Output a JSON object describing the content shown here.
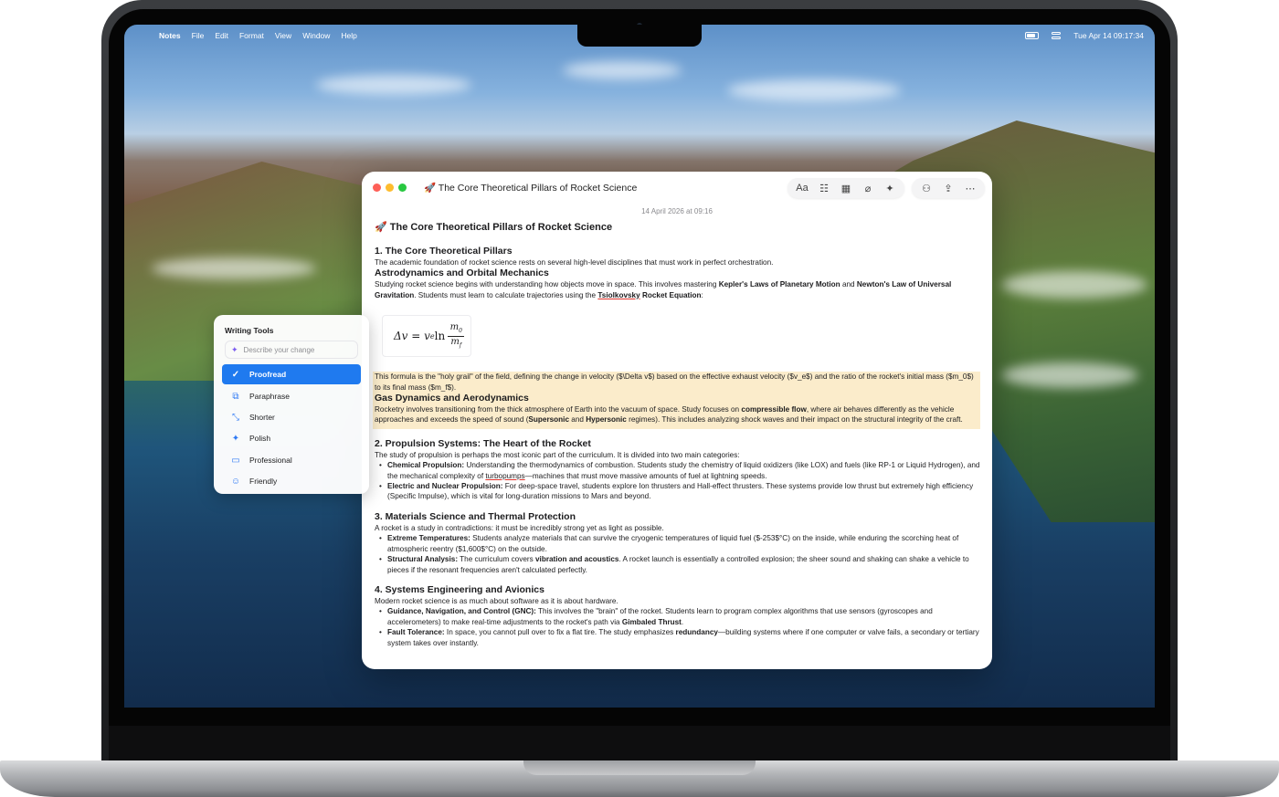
{
  "menubar": {
    "apple": "",
    "app": "Notes",
    "items": [
      "File",
      "Edit",
      "Format",
      "View",
      "Window",
      "Help"
    ],
    "clock": "Tue Apr 14  09:17:34"
  },
  "window": {
    "title": "🚀 The Core Theoretical Pillars of Rocket Science",
    "toolbar": {
      "format": "Aa",
      "checklist": "☷",
      "table": "▦",
      "attach": "⌀",
      "ai": "✦",
      "collab": "⚇",
      "share": "⇪",
      "more": "⋯"
    },
    "date": "14 April 2026 at 09:16"
  },
  "note": {
    "title": "🚀 The Core Theoretical Pillars of Rocket Science",
    "s1_heading": "1. The Core Theoretical Pillars",
    "s1_intro": "The academic foundation of rocket science rests on several high-level disciplines that must work in perfect orchestration.",
    "astro_heading": "Astrodynamics and Orbital Mechanics",
    "astro_p1": "Studying rocket science begins with understanding how objects move in space. This involves mastering ",
    "astro_b1": "Kepler's Laws of Planetary Motion",
    "astro_p2": " and ",
    "astro_b2": "Newton's Law of Universal Gravitation",
    "astro_p3": ". Students must learn to calculate trajectories using the ",
    "astro_b3": "Tsiolkovsky",
    "astro_b3b": " Rocket Equation",
    "astro_p4": ":",
    "formula": {
      "lhs": "Δv = v",
      "sub": "e",
      "ln": " ln",
      "num": "m",
      "num_sub": "0",
      "den": "m",
      "den_sub": "f"
    },
    "formula_note": "This formula is the \"holy grail\" of the field, defining the change in velocity ($\\Delta v$) based on the effective exhaust velocity ($v_e$) and the ratio of the rocket's initial mass ($m_0$) to its final mass ($m_f$).",
    "gas_heading": "Gas Dynamics and Aerodynamics",
    "gas_p1": "Rocketry involves transitioning from the thick atmosphere of Earth into the vacuum of space. Study focuses on ",
    "gas_b1": "compressible flow",
    "gas_p2": ", where air behaves differently as the vehicle approaches and exceeds the speed of sound (",
    "gas_b2": "Supersonic",
    "gas_p3": " and ",
    "gas_b3": "Hypersonic",
    "gas_p4": " regimes). This includes analyzing shock waves and their impact on the structural integrity of the craft.",
    "s2_heading": "2. Propulsion Systems: The Heart of the Rocket",
    "s2_intro": "The study of propulsion is perhaps the most iconic part of the curriculum. It is divided into two main categories:",
    "s2_li1_b": "Chemical Propulsion:",
    "s2_li1_a": " Understanding the thermodynamics of combustion. Students study the chemistry of liquid oxidizers (like LOX) and fuels (like RP-1 or Liquid Hydrogen), and the mechanical complexity of ",
    "s2_li1_u": "turbopumps",
    "s2_li1_c": "—machines that must move massive amounts of fuel at lightning speeds.",
    "s2_li2_b": "Electric and Nuclear Propulsion:",
    "s2_li2_a": " For deep-space travel, students explore Ion thrusters and Hall-effect thrusters. These systems provide low thrust but extremely high efficiency (Specific Impulse), which is vital for long-duration missions to Mars and beyond.",
    "s3_heading": "3. Materials Science and Thermal Protection",
    "s3_intro": "A rocket is a study in contradictions: it must be incredibly strong yet as light as possible.",
    "s3_li1_b": "Extreme Temperatures:",
    "s3_li1_a": " Students analyze materials that can survive the cryogenic temperatures of liquid fuel ($-253$°C) on the inside, while enduring the scorching heat of atmospheric reentry ($1,600$°C) on the outside.",
    "s3_li2_b": "Structural Analysis:",
    "s3_li2_a": " The curriculum covers ",
    "s3_li2_b2": "vibration and acoustics",
    "s3_li2_c": ". A rocket launch is essentially a controlled explosion; the sheer sound and shaking can shake a vehicle to pieces if the resonant frequencies aren't calculated perfectly.",
    "s4_heading": "4. Systems Engineering and Avionics",
    "s4_intro": "Modern rocket science is as much about software as it is about hardware.",
    "s4_li1_b": "Guidance, Navigation, and Control (GNC):",
    "s4_li1_a": " This involves the \"brain\" of the rocket. Students learn to program complex algorithms that use sensors (gyroscopes and accelerometers) to make real-time adjustments to the rocket's path via ",
    "s4_li1_b2": "Gimbaled Thrust",
    "s4_li1_c": ".",
    "s4_li2_b": "Fault Tolerance:",
    "s4_li2_a": " In space, you cannot pull over to fix a flat tire. The study emphasizes ",
    "s4_li2_b2": "redundancy",
    "s4_li2_c": "—building systems where if one computer or valve fails, a secondary or tertiary system takes over instantly."
  },
  "writing_tools": {
    "title": "Writing Tools",
    "placeholder": "Describe your change",
    "items": [
      {
        "label": "Proofread",
        "icon": "✓",
        "selected": true
      },
      {
        "label": "Paraphrase",
        "icon": "⧉"
      },
      {
        "label": "Shorter",
        "icon": "⤡"
      },
      {
        "label": "Polish",
        "icon": "✦"
      },
      {
        "label": "Professional",
        "icon": "▭"
      },
      {
        "label": "Friendly",
        "icon": "☺"
      }
    ]
  },
  "colors": {
    "accent": "#1f7aef",
    "highlight": "#fbeccb"
  }
}
